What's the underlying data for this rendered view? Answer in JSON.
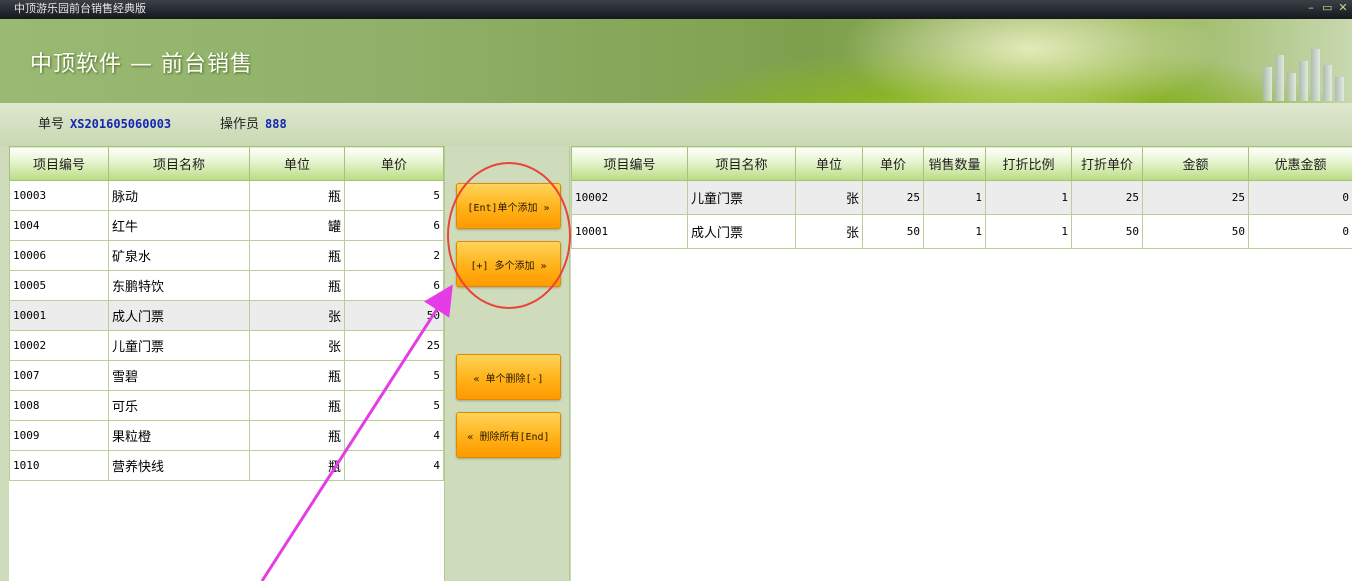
{
  "window": {
    "title": "中顶游乐园前台销售经典版",
    "controls": [
      "–",
      "▭",
      "✕"
    ]
  },
  "header": {
    "title": "中顶软件 — 前台销售"
  },
  "info": {
    "order_label": "单号",
    "order_value": "XS201605060003",
    "operator_label": "操作员",
    "operator_value": "888"
  },
  "product_table": {
    "headers": [
      "项目编号",
      "项目名称",
      "单位",
      "单价"
    ],
    "rows": [
      [
        "10003",
        "脉动",
        "瓶",
        "5"
      ],
      [
        "1004",
        "红牛",
        "罐",
        "6"
      ],
      [
        "10006",
        "矿泉水",
        "瓶",
        "2"
      ],
      [
        "10005",
        "东鹏特饮",
        "瓶",
        "6"
      ],
      [
        "10001",
        "成人门票",
        "张",
        "50"
      ],
      [
        "10002",
        "儿童门票",
        "张",
        "25"
      ],
      [
        "1007",
        "雪碧",
        "瓶",
        "5"
      ],
      [
        "1008",
        "可乐",
        "瓶",
        "5"
      ],
      [
        "1009",
        "果粒橙",
        "瓶",
        "4"
      ],
      [
        "1010",
        "营养快线",
        "瓶",
        "4"
      ]
    ]
  },
  "buttons": {
    "add_single": "[Ent]单个添加 »",
    "add_multi": "[+] 多个添加 »",
    "delete_single": "« 单个删除[-]",
    "delete_all": "« 删除所有[End]"
  },
  "sales_table": {
    "headers": [
      "项目编号",
      "项目名称",
      "单位",
      "单价",
      "销售数量",
      "打折比例",
      "打折单价",
      "金额",
      "优惠金额"
    ],
    "rows": [
      [
        "10002",
        "儿童门票",
        "张",
        "25",
        "1",
        "1",
        "25",
        "25",
        "0"
      ],
      [
        "10001",
        "成人门票",
        "张",
        "50",
        "1",
        "1",
        "50",
        "50",
        "0"
      ]
    ]
  },
  "colors": {
    "button": "#ffb218",
    "annotation_circle": "#e8443a",
    "annotation_arrow": "#e63ce6",
    "info_value": "#1326b5"
  }
}
